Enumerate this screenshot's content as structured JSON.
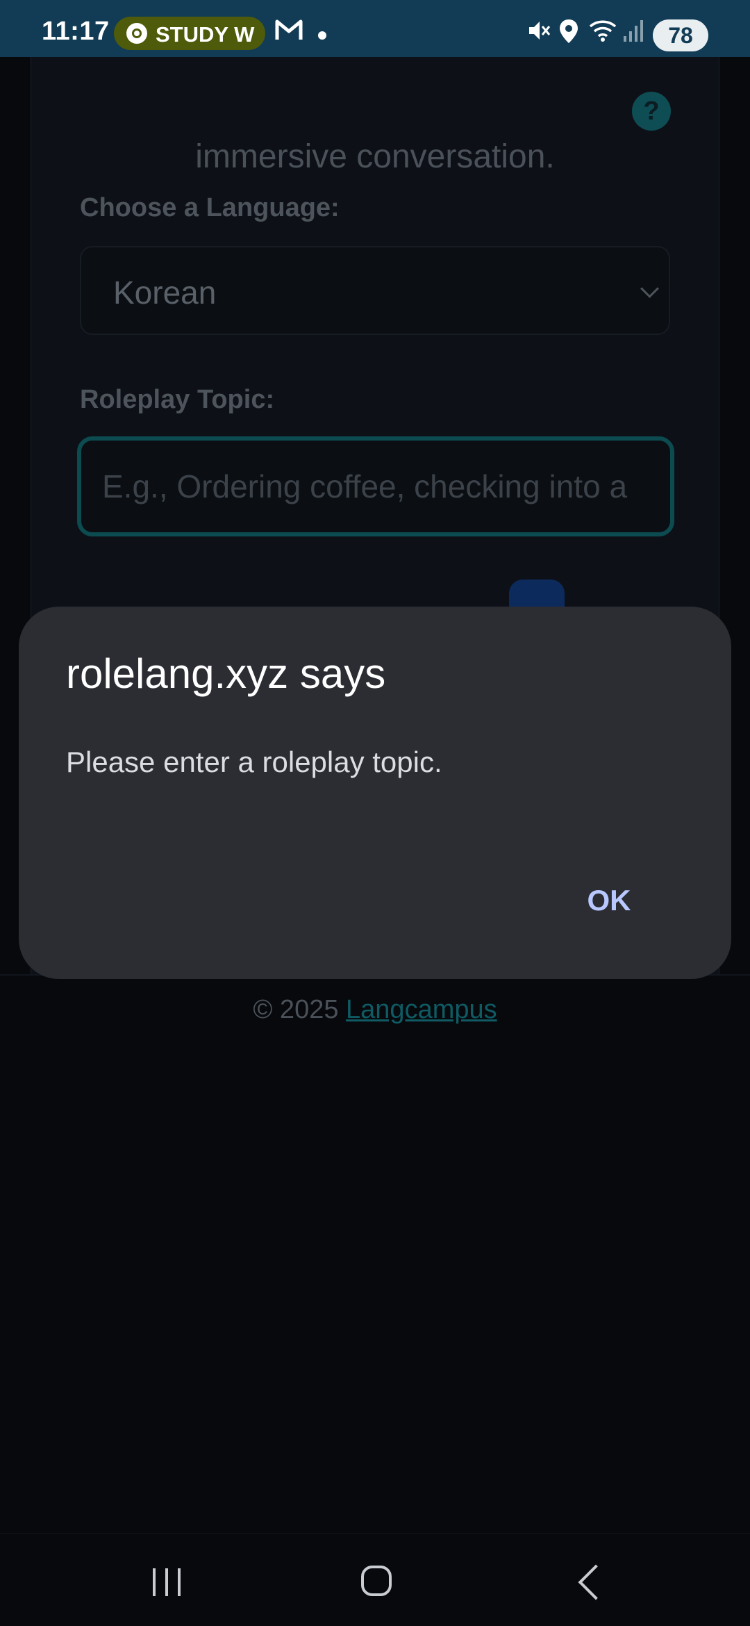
{
  "status_bar": {
    "time": "11:17",
    "pill_text": "STUDY W",
    "mail_icon": "gmail-icon",
    "battery": "78",
    "icons": [
      "mute-icon",
      "location-icon",
      "wifi-icon",
      "signal-icon",
      "battery-icon"
    ]
  },
  "page": {
    "subtitle_line": "immersive conversation.",
    "help_label": "?",
    "language_label": "Choose a Language:",
    "language_value": "Korean",
    "topic_label": "Roleplay Topic:",
    "topic_placeholder": "E.g., Ordering coffee, checking into a",
    "footer_prefix": "© 2025",
    "footer_link": "Langcampus"
  },
  "dialog": {
    "title": "rolelang.xyz says",
    "message": "Please enter a roleplay topic.",
    "ok_label": "OK"
  },
  "colors": {
    "status_bar": "#123c55",
    "dialog_bg": "#2c2d33",
    "ok_text": "#b9c9ff",
    "accent_teal": "#0c4b50"
  }
}
